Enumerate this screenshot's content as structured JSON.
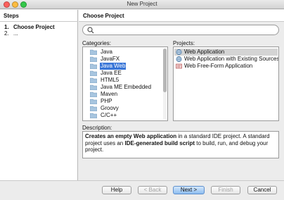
{
  "window": {
    "title": "New Project"
  },
  "steps": {
    "heading": "Steps",
    "items": [
      {
        "num": "1.",
        "label": "Choose Project"
      },
      {
        "num": "2.",
        "label": "..."
      }
    ]
  },
  "panel": {
    "title": "Choose Project"
  },
  "search": {
    "placeholder": ""
  },
  "categories": {
    "label": "Categories:",
    "items": [
      "Java",
      "JavaFX",
      "Java Web",
      "Java EE",
      "HTML5",
      "Java ME Embedded",
      "Maven",
      "PHP",
      "Groovy",
      "C/C++"
    ],
    "selected": "Java Web"
  },
  "projects": {
    "label": "Projects:",
    "items": [
      {
        "label": "Web Application",
        "icon": "web-app-globe-icon"
      },
      {
        "label": "Web Application with Existing Sources",
        "icon": "web-app-globe-icon"
      },
      {
        "label": "Web Free-Form Application",
        "icon": "web-freeform-icon"
      }
    ],
    "selected": "Web Application"
  },
  "description": {
    "label": "Description:",
    "p1": "Creates an empty Web application",
    "p2": " in a standard IDE project. A standard project uses an ",
    "p3": "IDE-generated build script",
    "p4": " to build, run, and debug your project."
  },
  "buttons": {
    "help": "Help",
    "back": "< Back",
    "next": "Next >",
    "finish": "Finish",
    "cancel": "Cancel"
  },
  "colors": {
    "selection": "#3875d7",
    "default_button": "#8dbdf0"
  }
}
